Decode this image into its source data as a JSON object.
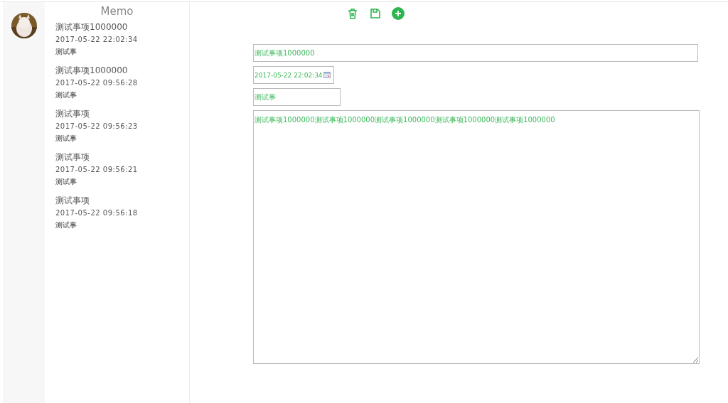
{
  "sidebar": {
    "title": "Memo",
    "items": [
      {
        "title": "测试事项1000000",
        "time": "2017-05-22 22:02:34",
        "note": "测试事"
      },
      {
        "title": "测试事项1000000",
        "time": "2017-05-22 09:56:28",
        "note": "测试事"
      },
      {
        "title": "测试事项",
        "time": "2017-05-22 09:56:23",
        "note": "测试事"
      },
      {
        "title": "测试事项",
        "time": "2017-05-22 09:56:21",
        "note": "测试事"
      },
      {
        "title": "测试事项",
        "time": "2017-05-22 09:56:18",
        "note": "测试事"
      }
    ]
  },
  "editor": {
    "title": "测试事项1000000",
    "time": "2017-05-22 22:02:34",
    "note": "测试事",
    "content": "测试事项1000000测试事项1000000测试事项1000000测试事项1000000测试事项1000000"
  }
}
